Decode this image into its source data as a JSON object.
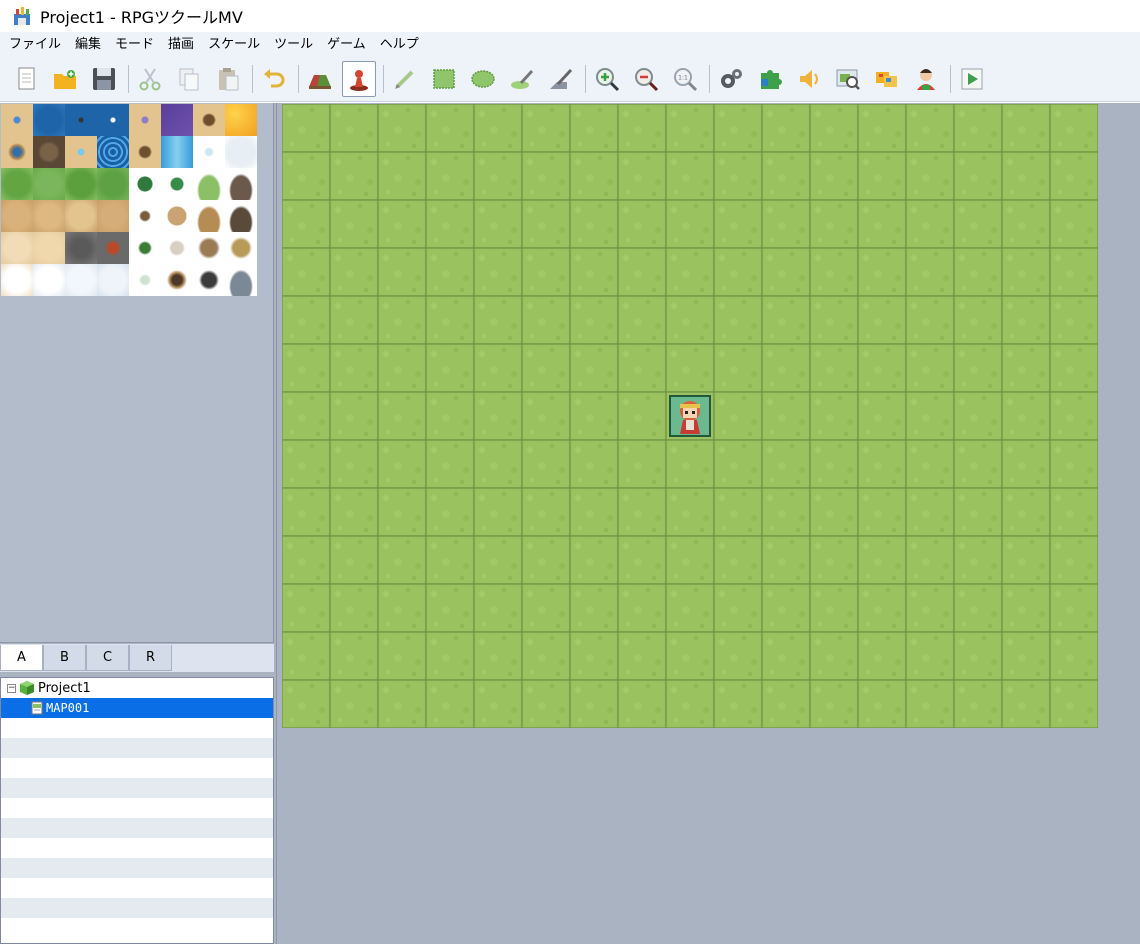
{
  "window": {
    "title": "Project1 - RPGツクールMV"
  },
  "menu": [
    "ファイル",
    "編集",
    "モード",
    "描画",
    "スケール",
    "ツール",
    "ゲーム",
    "ヘルプ"
  ],
  "toolbar": [
    {
      "name": "new-project-icon",
      "group": 0
    },
    {
      "name": "open-project-icon",
      "group": 0
    },
    {
      "name": "save-project-icon",
      "group": 0
    },
    {
      "name": "cut-icon",
      "group": 1
    },
    {
      "name": "copy-icon",
      "group": 1
    },
    {
      "name": "paste-icon",
      "group": 1
    },
    {
      "name": "undo-icon",
      "group": 2
    },
    {
      "name": "map-mode-icon",
      "group": 3
    },
    {
      "name": "event-mode-icon",
      "group": 3,
      "active": true
    },
    {
      "name": "pencil-icon",
      "group": 4
    },
    {
      "name": "rectangle-icon",
      "group": 4
    },
    {
      "name": "ellipse-icon",
      "group": 4
    },
    {
      "name": "fill-icon",
      "group": 4
    },
    {
      "name": "shadow-pen-icon",
      "group": 4
    },
    {
      "name": "zoom-in-icon",
      "group": 5
    },
    {
      "name": "zoom-out-icon",
      "group": 5
    },
    {
      "name": "zoom-actual-icon",
      "group": 5,
      "label": "1:1"
    },
    {
      "name": "database-icon",
      "group": 6
    },
    {
      "name": "plugin-manager-icon",
      "group": 6
    },
    {
      "name": "sound-test-icon",
      "group": 6
    },
    {
      "name": "event-searcher-icon",
      "group": 6
    },
    {
      "name": "resource-manager-icon",
      "group": 6
    },
    {
      "name": "character-generator-icon",
      "group": 6
    },
    {
      "name": "playtest-icon",
      "group": 7
    }
  ],
  "tile_tabs": [
    "A",
    "B",
    "C",
    "R"
  ],
  "map_tree": [
    {
      "label": "Project1",
      "level": 0,
      "type": "project",
      "expander": "−"
    },
    {
      "label": "MAP001",
      "level": 1,
      "type": "map",
      "selected": true
    }
  ],
  "map": {
    "cols": 17,
    "rows": 13,
    "event_col": 8,
    "event_row": 6
  },
  "colors": {
    "grass": "#9ac25e",
    "grid": "#6f8f47",
    "selection": "#0a6fe6"
  }
}
